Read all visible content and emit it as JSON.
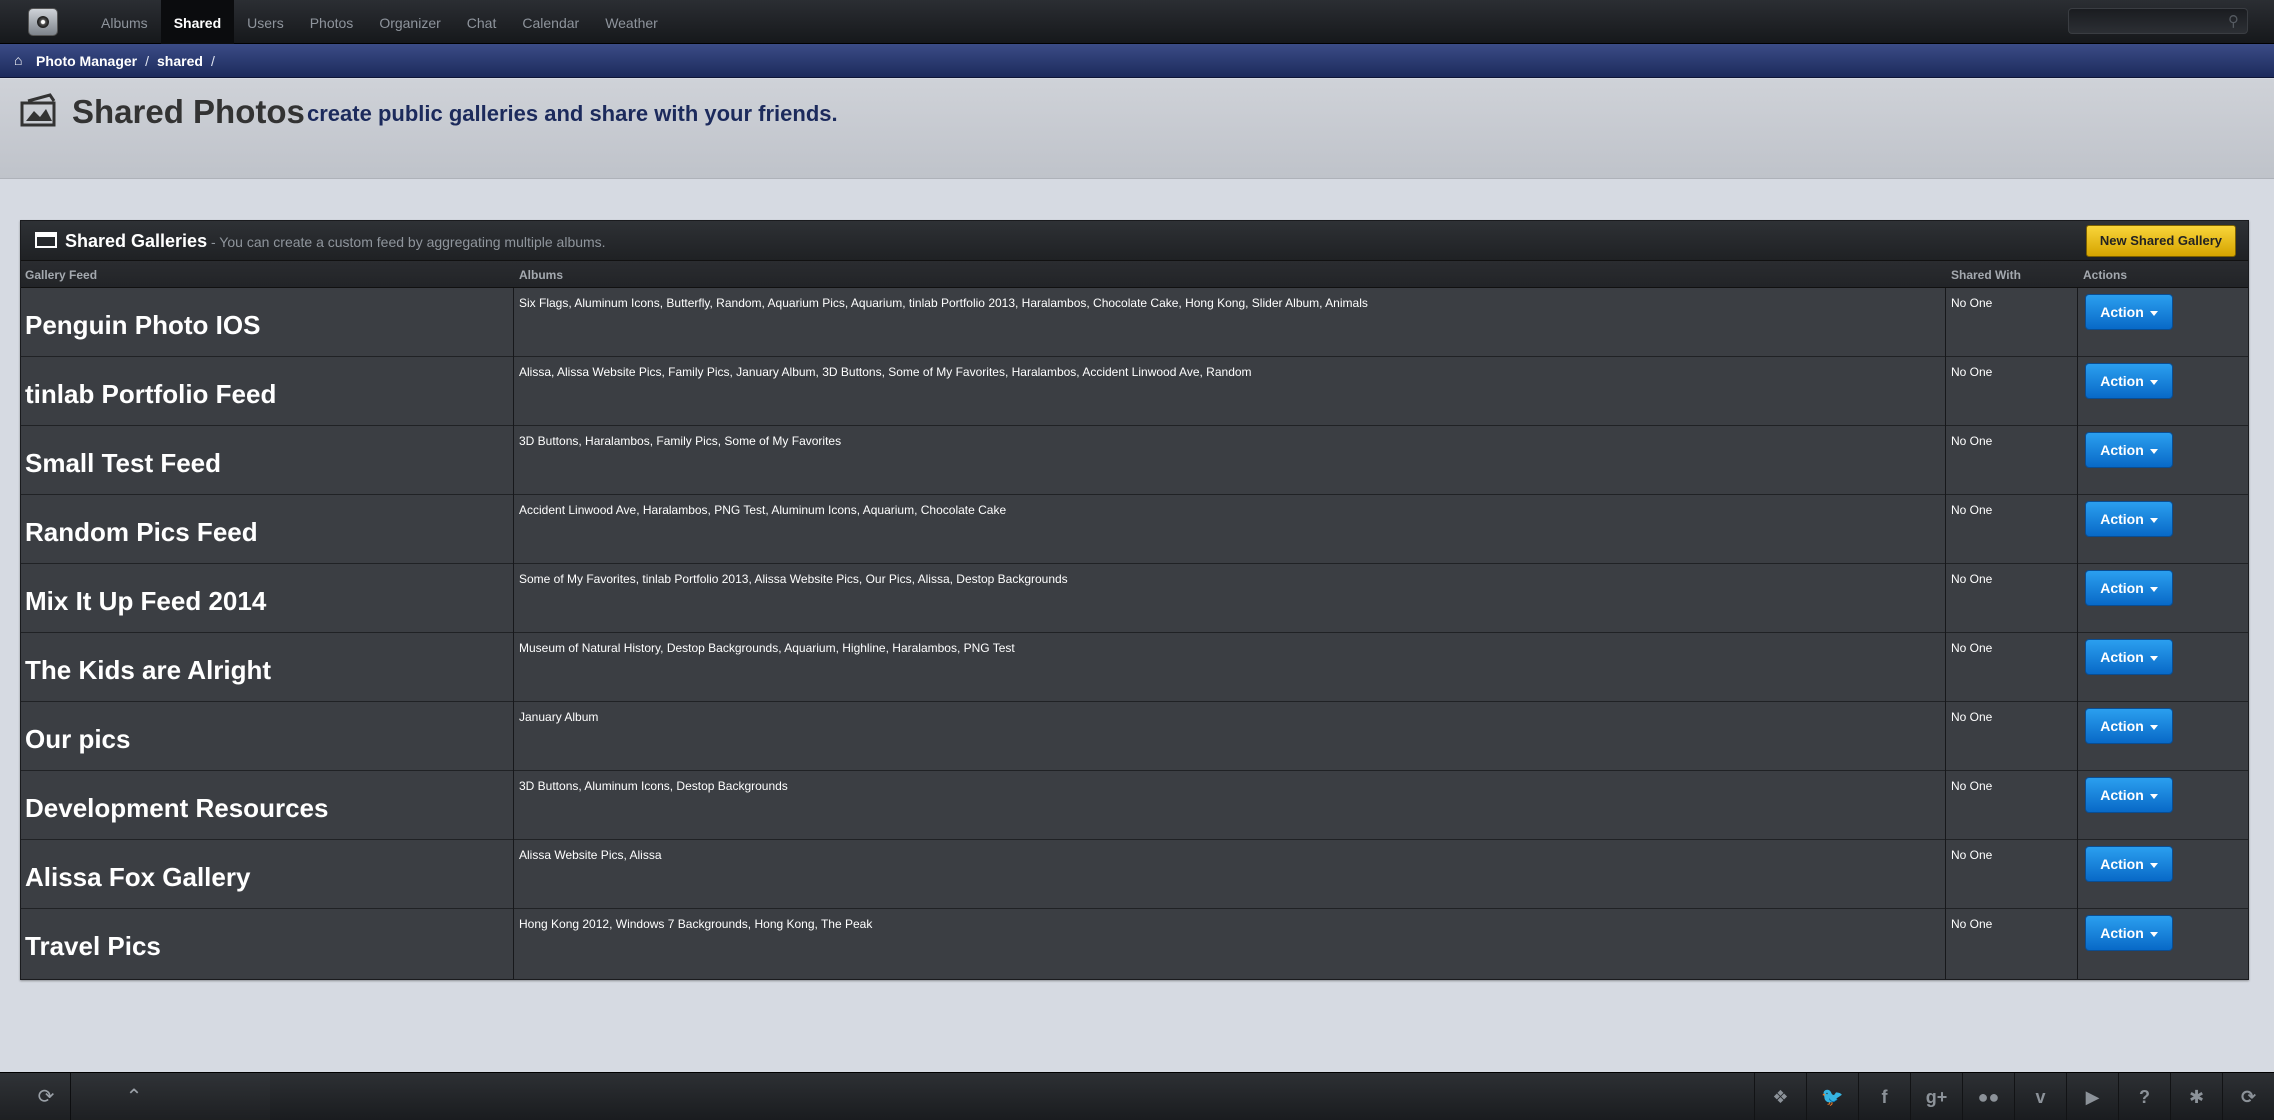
{
  "nav": {
    "items": [
      {
        "label": "Albums",
        "active": false
      },
      {
        "label": "Shared",
        "active": true
      },
      {
        "label": "Users",
        "active": false
      },
      {
        "label": "Photos",
        "active": false
      },
      {
        "label": "Organizer",
        "active": false
      },
      {
        "label": "Chat",
        "active": false
      },
      {
        "label": "Calendar",
        "active": false
      },
      {
        "label": "Weather",
        "active": false
      }
    ],
    "search_placeholder": ""
  },
  "breadcrumb": {
    "items": [
      "Photo Manager",
      "shared"
    ]
  },
  "header": {
    "title": "Shared Photos",
    "subtitle": "create public galleries and share with your friends."
  },
  "panel": {
    "title": "Shared Galleries",
    "description": "- You can create a custom feed by aggregating multiple albums.",
    "new_button": "New Shared Gallery",
    "columns": [
      "Gallery Feed",
      "Albums",
      "Shared With",
      "Actions"
    ],
    "action_label": "Action",
    "rows": [
      {
        "name": "Penguin Photo IOS",
        "albums": "Six Flags, Aluminum Icons, Butterfly, Random, Aquarium Pics, Aquarium, tinlab Portfolio 2013, Haralambos, Chocolate Cake, Hong Kong, Slider Album, Animals",
        "shared": "No One"
      },
      {
        "name": "tinlab Portfolio Feed",
        "albums": "Alissa, Alissa Website Pics, Family Pics, January Album, 3D Buttons, Some of My Favorites, Haralambos, Accident Linwood Ave, Random",
        "shared": "No One"
      },
      {
        "name": "Small Test Feed",
        "albums": "3D Buttons, Haralambos, Family Pics, Some of My Favorites",
        "shared": "No One"
      },
      {
        "name": "Random Pics Feed",
        "albums": "Accident Linwood Ave, Haralambos, PNG Test, Aluminum Icons, Aquarium, Chocolate Cake",
        "shared": "No One"
      },
      {
        "name": "Mix It Up Feed 2014",
        "albums": "Some of My Favorites, tinlab Portfolio 2013, Alissa Website Pics, Our Pics, Alissa, Destop Backgrounds",
        "shared": "No One"
      },
      {
        "name": "The Kids are Alright",
        "albums": "Museum of Natural History, Destop Backgrounds, Aquarium, Highline, Haralambos, PNG Test",
        "shared": "No One"
      },
      {
        "name": "Our pics",
        "albums": "January Album",
        "shared": "No One"
      },
      {
        "name": "Development Resources",
        "albums": "3D Buttons, Aluminum Icons, Destop Backgrounds",
        "shared": "No One"
      },
      {
        "name": "Alissa Fox Gallery",
        "albums": "Alissa Website Pics, Alissa",
        "shared": "No One"
      },
      {
        "name": "Travel Pics",
        "albums": "Hong Kong 2012, Windows 7 Backgrounds, Hong Kong, The Peak",
        "shared": "No One"
      }
    ]
  },
  "footer": {
    "left_icons": [
      "refresh-icon",
      "chevron-up-icon"
    ],
    "social_icons": [
      {
        "name": "dropbox-icon",
        "glyph": "❖"
      },
      {
        "name": "twitter-icon",
        "glyph": "🐦"
      },
      {
        "name": "facebook-icon",
        "glyph": "f"
      },
      {
        "name": "google-plus-icon",
        "glyph": "g+"
      },
      {
        "name": "flickr-icon",
        "glyph": "●●"
      },
      {
        "name": "vimeo-icon",
        "glyph": "v"
      },
      {
        "name": "youtube-icon",
        "glyph": "▶"
      },
      {
        "name": "help-icon",
        "glyph": "?"
      },
      {
        "name": "settings-icon",
        "glyph": "✱"
      },
      {
        "name": "logout-icon",
        "glyph": "⟳"
      }
    ]
  }
}
